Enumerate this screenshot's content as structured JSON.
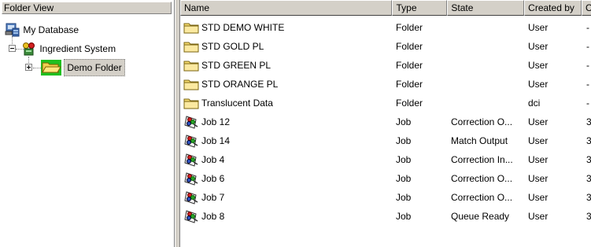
{
  "folder_view": {
    "header": "Folder View",
    "tree": {
      "root": "My Database",
      "child": "Ingredient System",
      "grandchild": "Demo Folder"
    }
  },
  "list": {
    "columns": [
      "Name",
      "Type",
      "State",
      "Created by",
      "C"
    ],
    "rows": [
      {
        "name": "STD DEMO WHITE",
        "type": "Folder",
        "state": "",
        "created_by": "User",
        "extra": "-",
        "icon": "folder-icon"
      },
      {
        "name": "STD GOLD PL",
        "type": "Folder",
        "state": "",
        "created_by": "User",
        "extra": "-",
        "icon": "folder-icon"
      },
      {
        "name": "STD GREEN PL",
        "type": "Folder",
        "state": "",
        "created_by": "User",
        "extra": "-",
        "icon": "folder-icon"
      },
      {
        "name": "STD ORANGE PL",
        "type": "Folder",
        "state": "",
        "created_by": "User",
        "extra": "-",
        "icon": "folder-icon"
      },
      {
        "name": "Translucent Data",
        "type": "Folder",
        "state": "",
        "created_by": "dci",
        "extra": "-",
        "icon": "folder-icon"
      },
      {
        "name": "Job 12",
        "type": "Job",
        "state": "Correction O...",
        "created_by": "User",
        "extra": "3",
        "icon": "job-icon"
      },
      {
        "name": "Job 14",
        "type": "Job",
        "state": "Match Output",
        "created_by": "User",
        "extra": "3",
        "icon": "job-icon"
      },
      {
        "name": "Job 4",
        "type": "Job",
        "state": "Correction In...",
        "created_by": "User",
        "extra": "3",
        "icon": "job-icon"
      },
      {
        "name": "Job 6",
        "type": "Job",
        "state": "Correction O...",
        "created_by": "User",
        "extra": "3",
        "icon": "job-icon"
      },
      {
        "name": "Job 7",
        "type": "Job",
        "state": "Correction O...",
        "created_by": "User",
        "extra": "3",
        "icon": "job-icon"
      },
      {
        "name": "Job 8",
        "type": "Job",
        "state": "Queue Ready",
        "created_by": "User",
        "extra": "3",
        "icon": "job-icon"
      }
    ]
  }
}
